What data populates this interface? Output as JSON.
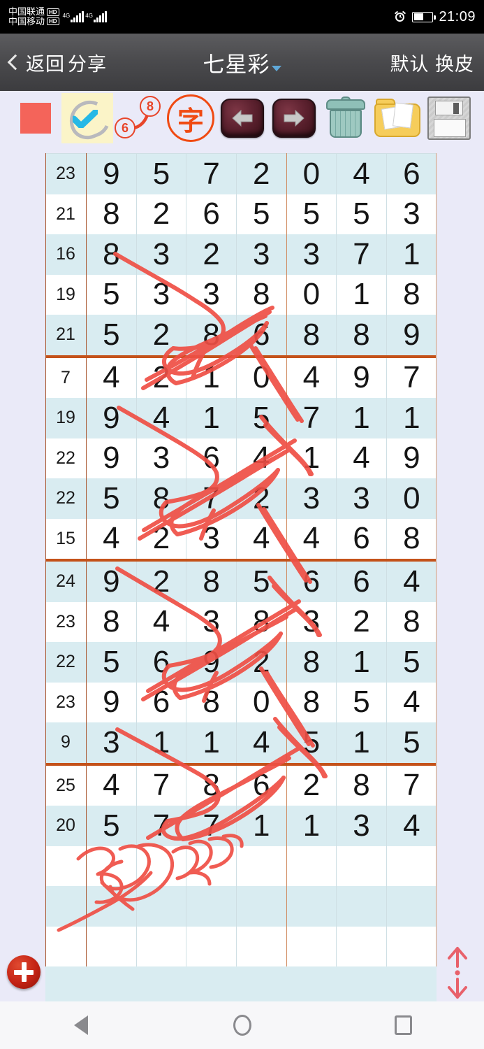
{
  "status_bar": {
    "carrier_top": "中国联通",
    "carrier_bottom": "中国移动",
    "hd_badge": "HD",
    "network_type": "4G",
    "time": "21:09",
    "alarm_icon": "alarm-clock-icon",
    "battery_icon": "battery-half-icon"
  },
  "title_bar": {
    "back_label": "返回",
    "share_label": "分享",
    "title": "七星彩",
    "dropdown_icon": "chevron-down-icon",
    "right_label_1": "默认",
    "right_label_2": "换皮"
  },
  "toolbar": {
    "items": [
      {
        "name": "color-swatch",
        "label": "",
        "color": "#f4645a",
        "selected": false
      },
      {
        "name": "pen-tool",
        "label": "",
        "selected": true
      },
      {
        "name": "stroke-width-tool",
        "label": "",
        "min": "6",
        "max": "8",
        "selected": false
      },
      {
        "name": "text-stamp-tool",
        "label": "字",
        "selected": false
      },
      {
        "name": "undo-button",
        "label": "",
        "selected": false
      },
      {
        "name": "redo-button",
        "label": "",
        "selected": false
      },
      {
        "name": "trash-button",
        "label": "",
        "selected": false
      },
      {
        "name": "gallery-button",
        "label": "",
        "selected": false
      },
      {
        "name": "save-button",
        "label": "",
        "selected": false
      }
    ],
    "stroke_min": "6",
    "stroke_max": "8",
    "stamp_char": "字"
  },
  "table": {
    "columns": 8,
    "group_size": 5,
    "rows": [
      {
        "sum": "23",
        "digits": [
          "9",
          "5",
          "7",
          "2",
          "0",
          "4",
          "6"
        ]
      },
      {
        "sum": "21",
        "digits": [
          "8",
          "2",
          "6",
          "5",
          "5",
          "5",
          "3"
        ]
      },
      {
        "sum": "16",
        "digits": [
          "8",
          "3",
          "2",
          "3",
          "3",
          "7",
          "1"
        ]
      },
      {
        "sum": "19",
        "digits": [
          "5",
          "3",
          "3",
          "8",
          "0",
          "1",
          "8"
        ]
      },
      {
        "sum": "21",
        "digits": [
          "5",
          "2",
          "8",
          "6",
          "8",
          "8",
          "9"
        ]
      },
      {
        "sum": "7",
        "digits": [
          "4",
          "2",
          "1",
          "0",
          "4",
          "9",
          "7"
        ]
      },
      {
        "sum": "19",
        "digits": [
          "9",
          "4",
          "1",
          "5",
          "7",
          "1",
          "1"
        ]
      },
      {
        "sum": "22",
        "digits": [
          "9",
          "3",
          "6",
          "4",
          "1",
          "4",
          "9"
        ]
      },
      {
        "sum": "22",
        "digits": [
          "5",
          "8",
          "7",
          "2",
          "3",
          "3",
          "0"
        ]
      },
      {
        "sum": "15",
        "digits": [
          "4",
          "2",
          "3",
          "4",
          "4",
          "6",
          "8"
        ]
      },
      {
        "sum": "24",
        "digits": [
          "9",
          "2",
          "8",
          "5",
          "6",
          "6",
          "4"
        ]
      },
      {
        "sum": "23",
        "digits": [
          "8",
          "4",
          "3",
          "8",
          "3",
          "2",
          "8"
        ]
      },
      {
        "sum": "22",
        "digits": [
          "5",
          "6",
          "9",
          "2",
          "8",
          "1",
          "5"
        ]
      },
      {
        "sum": "23",
        "digits": [
          "9",
          "6",
          "8",
          "0",
          "8",
          "5",
          "4"
        ]
      },
      {
        "sum": "9",
        "digits": [
          "3",
          "1",
          "1",
          "4",
          "5",
          "1",
          "5"
        ]
      },
      {
        "sum": "25",
        "digits": [
          "4",
          "7",
          "8",
          "6",
          "2",
          "8",
          "7"
        ]
      },
      {
        "sum": "20",
        "digits": [
          "5",
          "7",
          "7",
          "1",
          "1",
          "3",
          "4"
        ]
      },
      {
        "sum": "",
        "digits": [
          "",
          "",
          "",
          "",
          "",
          "",
          ""
        ]
      },
      {
        "sum": "",
        "digits": [
          "",
          "",
          "",
          "",
          "",
          "",
          ""
        ]
      },
      {
        "sum": "",
        "digits": [
          "",
          "",
          "",
          "",
          "",
          "",
          ""
        ]
      }
    ]
  },
  "controls": {
    "add_button": "add-row-button",
    "scroll_updown": "scroll-up-down-control"
  },
  "nav_bar": {
    "back": "back-nav-button",
    "home": "home-nav-button",
    "recents": "recents-nav-button"
  },
  "colors": {
    "accent_red": "#f4645a",
    "ink_red": "#ef4f45",
    "row_alt": "#d9ecf1",
    "group_line": "#c4521a",
    "page_bg": "#eaeaf8",
    "title_bar": "#4b4b4e"
  }
}
